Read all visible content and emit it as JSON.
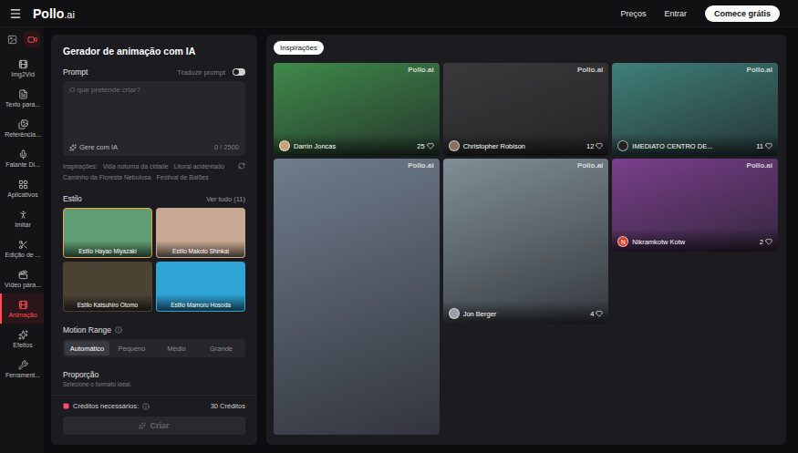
{
  "logo": {
    "name": "Pollo",
    "suffix": ".ai"
  },
  "topnav": {
    "links": [
      "Preços",
      "Entrar"
    ],
    "cta": "Comece grátis"
  },
  "sidebar": {
    "modes": [
      {
        "kind": "image",
        "selected": false
      },
      {
        "kind": "video",
        "selected": true
      }
    ],
    "items": [
      {
        "label": "Img2Vid",
        "selected": false
      },
      {
        "label": "Texto para...",
        "selected": false
      },
      {
        "label": "Referência...",
        "selected": false
      },
      {
        "label": "Falante Di...",
        "selected": false
      },
      {
        "label": "Aplicativos",
        "selected": false
      },
      {
        "label": "Imitar",
        "selected": false
      },
      {
        "label": "Edição de ...",
        "selected": false
      },
      {
        "label": "Vídeo para...",
        "selected": false
      },
      {
        "label": "Animação",
        "selected": true
      },
      {
        "label": "Efeitos",
        "selected": false
      },
      {
        "label": "Ferrament...",
        "selected": false
      }
    ]
  },
  "form": {
    "title": "Gerador de animação com IA",
    "prompt": {
      "label": "Prompt",
      "toggle": {
        "label": "Traduzir prompt",
        "on": false
      },
      "placeholder": "O que pretende criar?",
      "generate": "Gere com IA",
      "counter": "0 / 2500"
    },
    "inspirations": {
      "label": "Inspirações:",
      "items": [
        "Vida noturna da cidade",
        "Litoral acidentado",
        "Caminho da Floresta Nebulosa",
        "Festival de Balões"
      ]
    },
    "style": {
      "label": "Estilo",
      "see_all": "Ver tudo (11)",
      "options": [
        {
          "label": "Estilo Hayao Miyazaki",
          "selected": true,
          "color": "#5f9e74"
        },
        {
          "label": "Estilo Makoto Shinkai",
          "selected": false,
          "color": "#c8a994"
        },
        {
          "label": "Estilo Katsuhiro Otomo",
          "selected": false,
          "color": "#4a4334"
        },
        {
          "label": "Estilo Mamoru Hosoda",
          "selected": false,
          "color": "#2fa4d6"
        }
      ]
    },
    "motion": {
      "label": "Motion Range",
      "options": [
        {
          "label": "Automático",
          "selected": true
        },
        {
          "label": "Pequeno",
          "selected": false
        },
        {
          "label": "Médio",
          "selected": false
        },
        {
          "label": "Grande",
          "selected": false
        }
      ]
    },
    "ratio": {
      "label": "Proporção",
      "hint": "Selecione o formato ideal."
    },
    "credits": {
      "label": "Créditos necessários:",
      "value": "30 Créditos"
    },
    "submit": {
      "label": "Criar",
      "disabled": true
    }
  },
  "gallery": {
    "tag": "Inspirações",
    "watermark": "Pollo.ai",
    "columns": [
      [
        {
          "kind": "wide",
          "color": "#3f8a4a",
          "author": "Darrin Joncas",
          "likes": "25",
          "avatar": "",
          "avatar_color": "#c9a27a"
        },
        {
          "kind": "tall",
          "color": "#6f7c8c"
        }
      ],
      [
        {
          "kind": "wide",
          "color": "#3a3a3a",
          "author": "Christopher Robison",
          "likes": "12",
          "avatar": "",
          "avatar_color": "#8a7060"
        },
        {
          "kind": "medium",
          "color": "#7f8f96",
          "author": "Jon Berger",
          "likes": "4",
          "avatar": "",
          "avatar_color": "#9aa0a6"
        }
      ],
      [
        {
          "kind": "wide",
          "color": "#3f7f78",
          "author": "IMEDIATO CENTRO DE...",
          "likes": "11",
          "avatar": "",
          "avatar_color": "#222222"
        },
        {
          "kind": "wide",
          "color": "#7a3f8c",
          "author": "Nikramkotw Kotw",
          "likes": "2",
          "avatar": "N",
          "avatar_color": "#d9432f"
        }
      ]
    ]
  }
}
